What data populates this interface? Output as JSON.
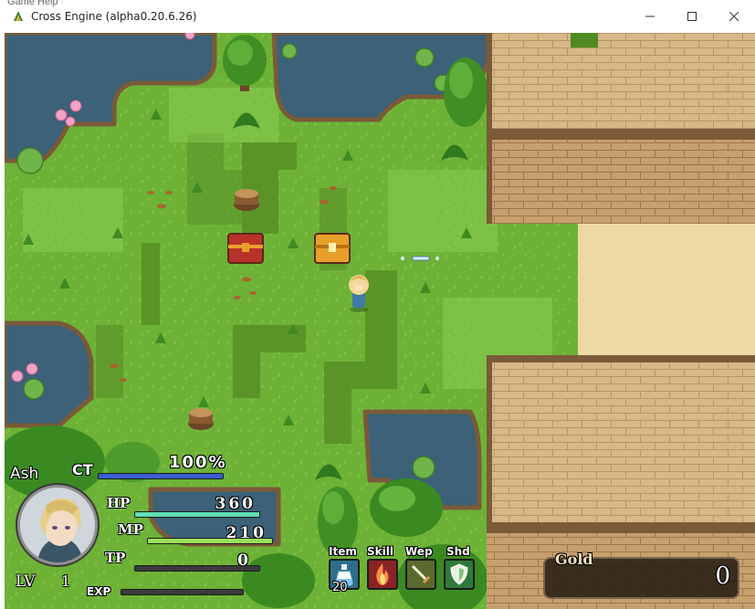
{
  "window": {
    "title": "Cross Engine (alpha0.20.6.26)",
    "menu_ghost": "Game  Help"
  },
  "hud": {
    "character_name": "Ash",
    "ct": {
      "label": "CT",
      "value": "100%",
      "fraction": 1.0
    },
    "hp": {
      "label": "HP",
      "value": "360",
      "fraction": 1.0
    },
    "mp": {
      "label": "MP",
      "value": "210",
      "fraction": 1.0
    },
    "tp": {
      "label": "TP",
      "value": "0",
      "fraction": 0.0
    },
    "level": {
      "label": "LV",
      "value": "1"
    },
    "exp": {
      "label": "EXP",
      "fraction": 0.0
    }
  },
  "hotbar": {
    "item": {
      "label": "Item",
      "count": "20",
      "icon": "potion-icon"
    },
    "skill": {
      "label": "Skill",
      "icon": "fire-icon"
    },
    "weapon": {
      "label": "Wep",
      "icon": "sword-icon"
    },
    "shield": {
      "label": "Shd",
      "icon": "shield-icon"
    }
  },
  "gold": {
    "label": "Gold",
    "value": "0"
  },
  "colors": {
    "grass": "#6db236",
    "grass_dark": "#4f8b22",
    "water": "#3c6178",
    "brick": "#d8b888",
    "sand": "#ecd9a6",
    "ct_bar": "#3a5fd0",
    "hp_bar": "#5fe0b5",
    "mp_bar": "#9be05a",
    "chest": "#e9a02a"
  }
}
